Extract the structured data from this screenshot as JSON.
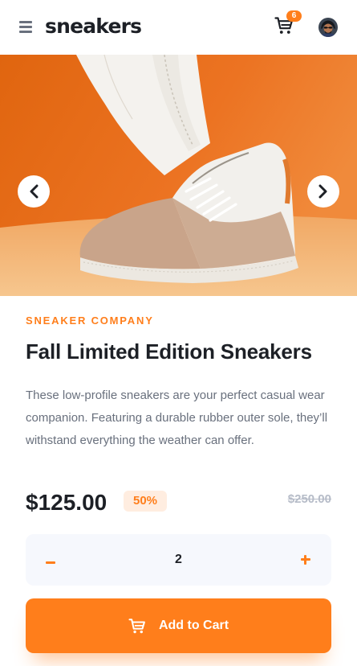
{
  "header": {
    "logo": "sneakers",
    "cart_count": "6"
  },
  "product": {
    "company": "SNEAKER COMPANY",
    "title": "Fall Limited Edition Sneakers",
    "description": "These low-profile sneakers are your perfect casual wear companion. Featuring a durable rubber outer sole, they’ll withstand everything the weather can offer.",
    "price": "$125.00",
    "discount": "50%",
    "original_price": "$250.00"
  },
  "quantity": {
    "value": "2"
  },
  "cta": {
    "label": "Add to Cart"
  },
  "colors": {
    "accent": "#ff7e1b",
    "accent_pale": "#ffede0",
    "dark": "#1d2026",
    "gray": "#69707d",
    "light_gray": "#b6bcc8",
    "surface": "#f6f8fd"
  },
  "icons": [
    "menu-icon",
    "cart-icon",
    "chevron-left-icon",
    "chevron-right-icon",
    "minus-icon",
    "plus-icon"
  ]
}
